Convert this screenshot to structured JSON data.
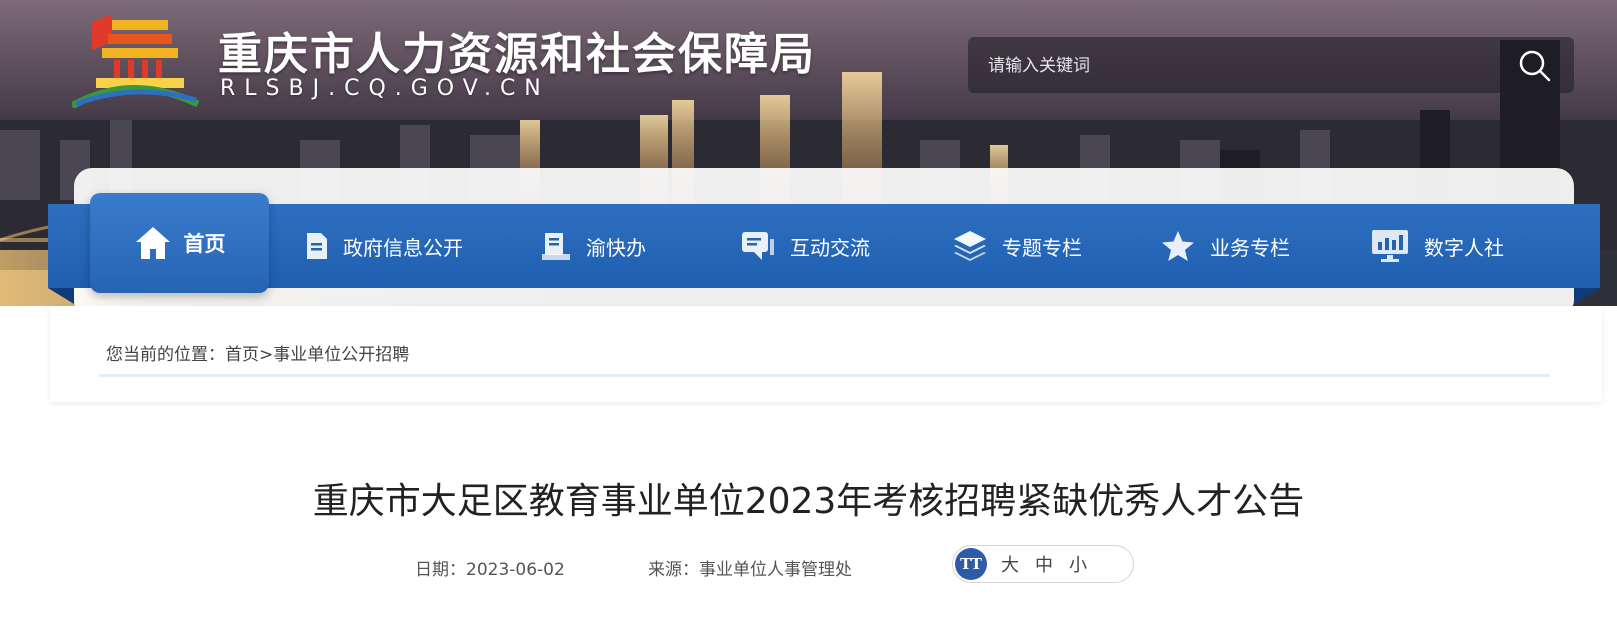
{
  "header": {
    "title": "重庆市人力资源和社会保障局",
    "domain": "RLSBJ.CQ.GOV.CN",
    "logo_icon": "temple-emblem-icon"
  },
  "search": {
    "placeholder": "请输入关键词",
    "icon": "search-icon"
  },
  "nav": {
    "items": [
      {
        "label": "首页",
        "icon": "home-icon",
        "active": true
      },
      {
        "label": "政府信息公开",
        "icon": "document-icon"
      },
      {
        "label": "渝快办",
        "icon": "clipboard-icon"
      },
      {
        "label": "互动交流",
        "icon": "chat-icon"
      },
      {
        "label": "专题专栏",
        "icon": "layers-icon"
      },
      {
        "label": "业务专栏",
        "icon": "star-icon"
      },
      {
        "label": "数字人社",
        "icon": "monitor-chart-icon"
      }
    ]
  },
  "breadcrumb": {
    "prefix": "您当前的位置：",
    "home": "首页",
    "separator": ">",
    "current": "事业单位公开招聘"
  },
  "article": {
    "title": "重庆市大足区教育事业单位2023年考核招聘紧缺优秀人才公告",
    "date_label": "日期：",
    "date": "2023-06-02",
    "source_label": "来源：",
    "source": "事业单位人事管理处"
  },
  "font_size": {
    "badge": "TT",
    "options": [
      "大",
      "中",
      "小"
    ]
  },
  "colors": {
    "nav_blue": "#2563ad",
    "badge_blue": "#2f5aa8"
  }
}
